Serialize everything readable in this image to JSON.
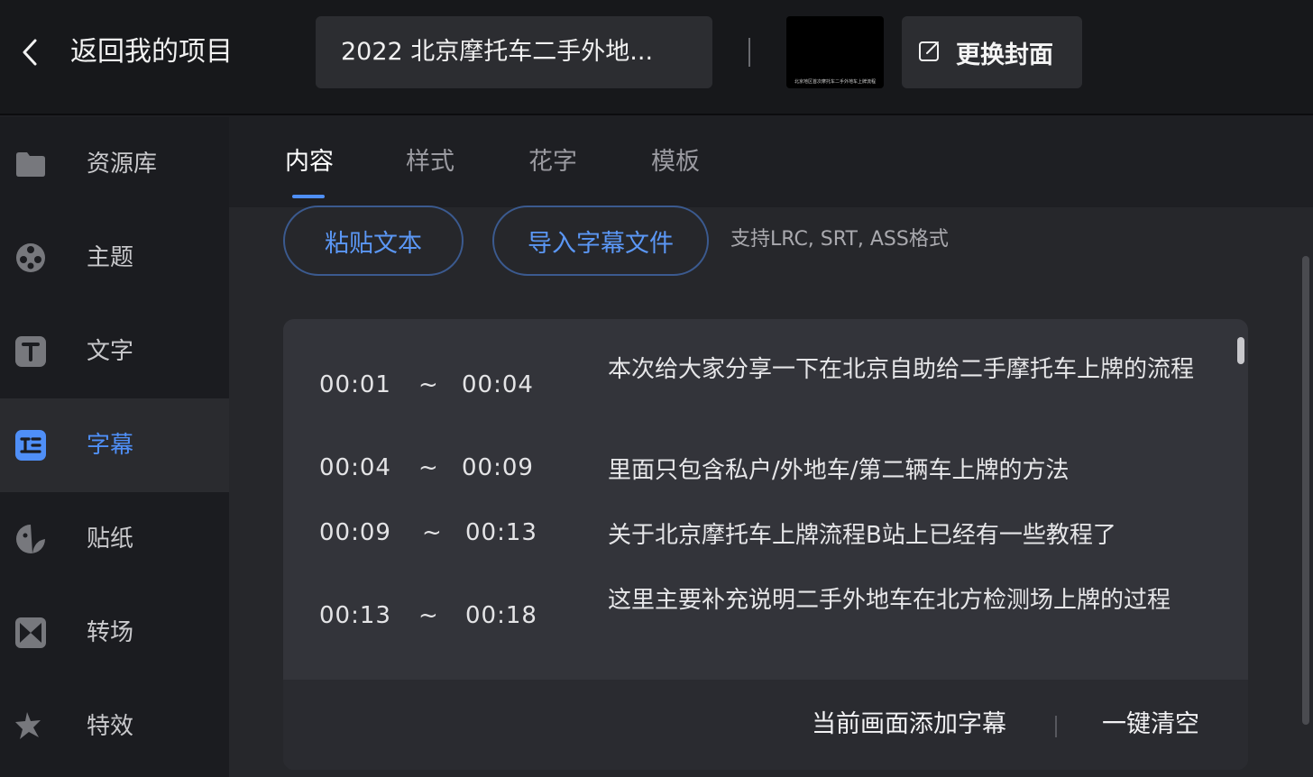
{
  "header": {
    "back_label": "返回我的项目",
    "project_title": "2022 北京摩托车二手外地...",
    "cover_caption": "北京地区首次摩托车二手外地车上牌流程",
    "change_cover_label": "更换封面"
  },
  "sidebar": {
    "items": [
      {
        "label": "资源库",
        "icon": "folder-icon"
      },
      {
        "label": "主题",
        "icon": "film-reel-icon"
      },
      {
        "label": "文字",
        "icon": "text-icon"
      },
      {
        "label": "字幕",
        "icon": "subtitle-icon",
        "active": true
      },
      {
        "label": "贴纸",
        "icon": "sticker-icon"
      },
      {
        "label": "转场",
        "icon": "transition-icon"
      },
      {
        "label": "特效",
        "icon": "effects-icon"
      }
    ]
  },
  "tabs": [
    {
      "label": "内容",
      "active": true
    },
    {
      "label": "样式"
    },
    {
      "label": "花字"
    },
    {
      "label": "模板"
    }
  ],
  "actions": {
    "paste_text": "粘贴文本",
    "import_file": "导入字幕文件",
    "support_note": "支持LRC, SRT, ASS格式"
  },
  "subtitles": [
    {
      "start": "00:01",
      "sep": "~",
      "end": "00:04",
      "text": "本次给大家分享一下在北京自助给二手摩托车上牌的流程"
    },
    {
      "start": "00:04",
      "sep": "~",
      "end": "00:09",
      "text": "里面只包含私户/外地车/第二辆车上牌的方法"
    },
    {
      "start": "00:09",
      "sep": "~",
      "end": "00:13",
      "text": "关于北京摩托车上牌流程B站上已经有一些教程了"
    },
    {
      "start": "00:13",
      "sep": "~",
      "end": "00:18",
      "text": "这里主要补充说明二手外地车在北方检测场上牌的过程"
    }
  ],
  "footer": {
    "add_subtitle": "当前画面添加字幕",
    "clear_all": "一键清空"
  },
  "colors": {
    "accent": "#4f8ff7",
    "background": "#1e1f23",
    "panel": "#33343a"
  }
}
